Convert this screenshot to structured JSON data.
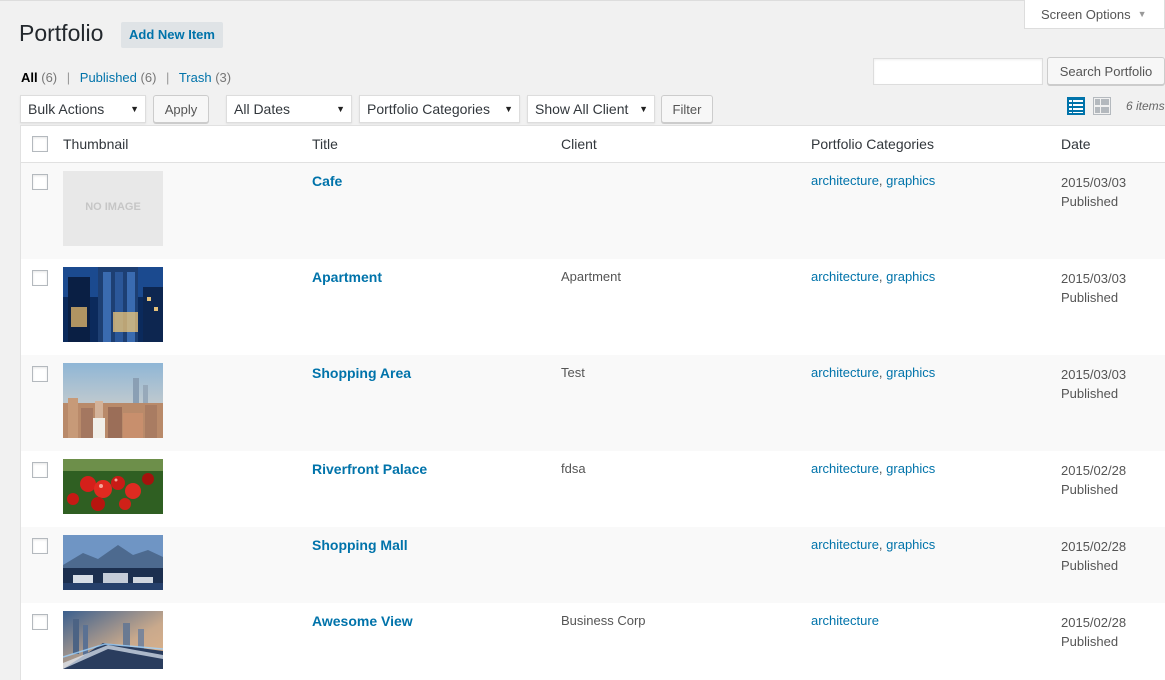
{
  "screen_options": {
    "label": "Screen Options"
  },
  "page": {
    "title": "Portfolio",
    "add_new": "Add New Item"
  },
  "filters_views": {
    "all": {
      "label": "All",
      "count": "(6)"
    },
    "published": {
      "label": "Published",
      "count": "(6)"
    },
    "trash": {
      "label": "Trash",
      "count": "(3)"
    },
    "separator": "|"
  },
  "search": {
    "button": "Search Portfolio",
    "value": ""
  },
  "toolbar": {
    "bulk_actions": "Bulk Actions",
    "apply": "Apply",
    "dates": "All Dates",
    "categories": "Portfolio Categories",
    "client": "Show All Client",
    "filter": "Filter",
    "items_count": "6 items"
  },
  "columns": {
    "thumbnail": "Thumbnail",
    "title": "Title",
    "client": "Client",
    "categories": "Portfolio Categories",
    "date": "Date"
  },
  "rows": [
    {
      "title": "Cafe",
      "client": "",
      "cats": [
        "architecture",
        "graphics"
      ],
      "date": "2015/03/03",
      "status": "Published",
      "thumb": "no-image",
      "thumb_text": "NO IMAGE"
    },
    {
      "title": "Apartment",
      "client": "Apartment",
      "cats": [
        "architecture",
        "graphics"
      ],
      "date": "2015/03/03",
      "status": "Published",
      "thumb": "building-photo"
    },
    {
      "title": "Shopping Area",
      "client": "Test",
      "cats": [
        "architecture",
        "graphics"
      ],
      "date": "2015/03/03",
      "status": "Published",
      "thumb": "city-skyline-photo"
    },
    {
      "title": "Riverfront Palace",
      "client": "fdsa",
      "cats": [
        "architecture",
        "graphics"
      ],
      "date": "2015/02/28",
      "status": "Published",
      "thumb": "tomatoes-photo"
    },
    {
      "title": "Shopping Mall",
      "client": "",
      "cats": [
        "architecture",
        "graphics"
      ],
      "date": "2015/02/28",
      "status": "Published",
      "thumb": "bay-city-photo"
    },
    {
      "title": "Awesome View",
      "client": "Business Corp",
      "cats": [
        "architecture"
      ],
      "date": "2015/02/28",
      "status": "Published",
      "thumb": "highway-city-photo"
    }
  ],
  "colors": {
    "link": "#0073aa",
    "bg": "#f1f1f1",
    "row_alt": "#f9f9f9"
  }
}
